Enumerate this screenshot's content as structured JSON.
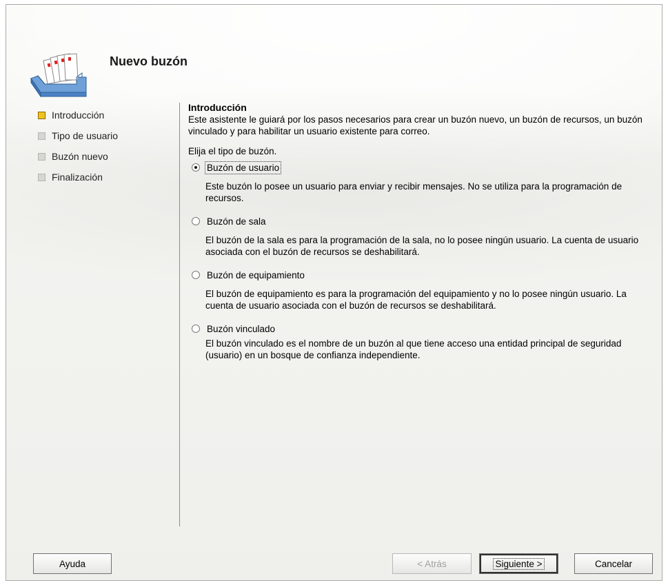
{
  "window": {
    "title": "Nuevo buzón"
  },
  "steps": [
    {
      "label": "Introducción",
      "active": true
    },
    {
      "label": "Tipo de usuario",
      "active": false
    },
    {
      "label": "Buzón nuevo",
      "active": false
    },
    {
      "label": "Finalización",
      "active": false
    }
  ],
  "content": {
    "section_title": "Introducción",
    "intro_text": "Este asistente le guiará por los pasos necesarios para crear un buzón nuevo, un buzón de recursos, un buzón vinculado y para habilitar un usuario existente para correo.",
    "prompt": "Elija el tipo de buzón.",
    "options": [
      {
        "label": "Buzón de usuario",
        "selected": true,
        "description": "Este buzón lo posee un usuario para enviar y recibir mensajes. No se utiliza para la programación de recursos."
      },
      {
        "label": "Buzón de sala",
        "selected": false,
        "description": "El buzón de la sala es para la programación de la sala, no lo posee ningún usuario. La cuenta de usuario asociada con el buzón de recursos se deshabilitará."
      },
      {
        "label": "Buzón de equipamiento",
        "selected": false,
        "description": "El buzón de equipamiento es para la programación del equipamiento y no lo posee ningún usuario. La cuenta de usuario asociada con el buzón de recursos se deshabilitará."
      },
      {
        "label": "Buzón vinculado",
        "selected": false,
        "description": "El buzón vinculado es el nombre de un buzón al que tiene acceso una entidad principal de seguridad (usuario) en un bosque de confianza independiente."
      }
    ]
  },
  "buttons": {
    "help": "Ayuda",
    "back": "< Atrás",
    "next": "Siguiente >",
    "cancel": "Cancelar"
  },
  "icons": {
    "header": "mailbox-icon"
  },
  "colors": {
    "active_step": "#f1c21f",
    "inactive_step": "#d6d6d2"
  }
}
